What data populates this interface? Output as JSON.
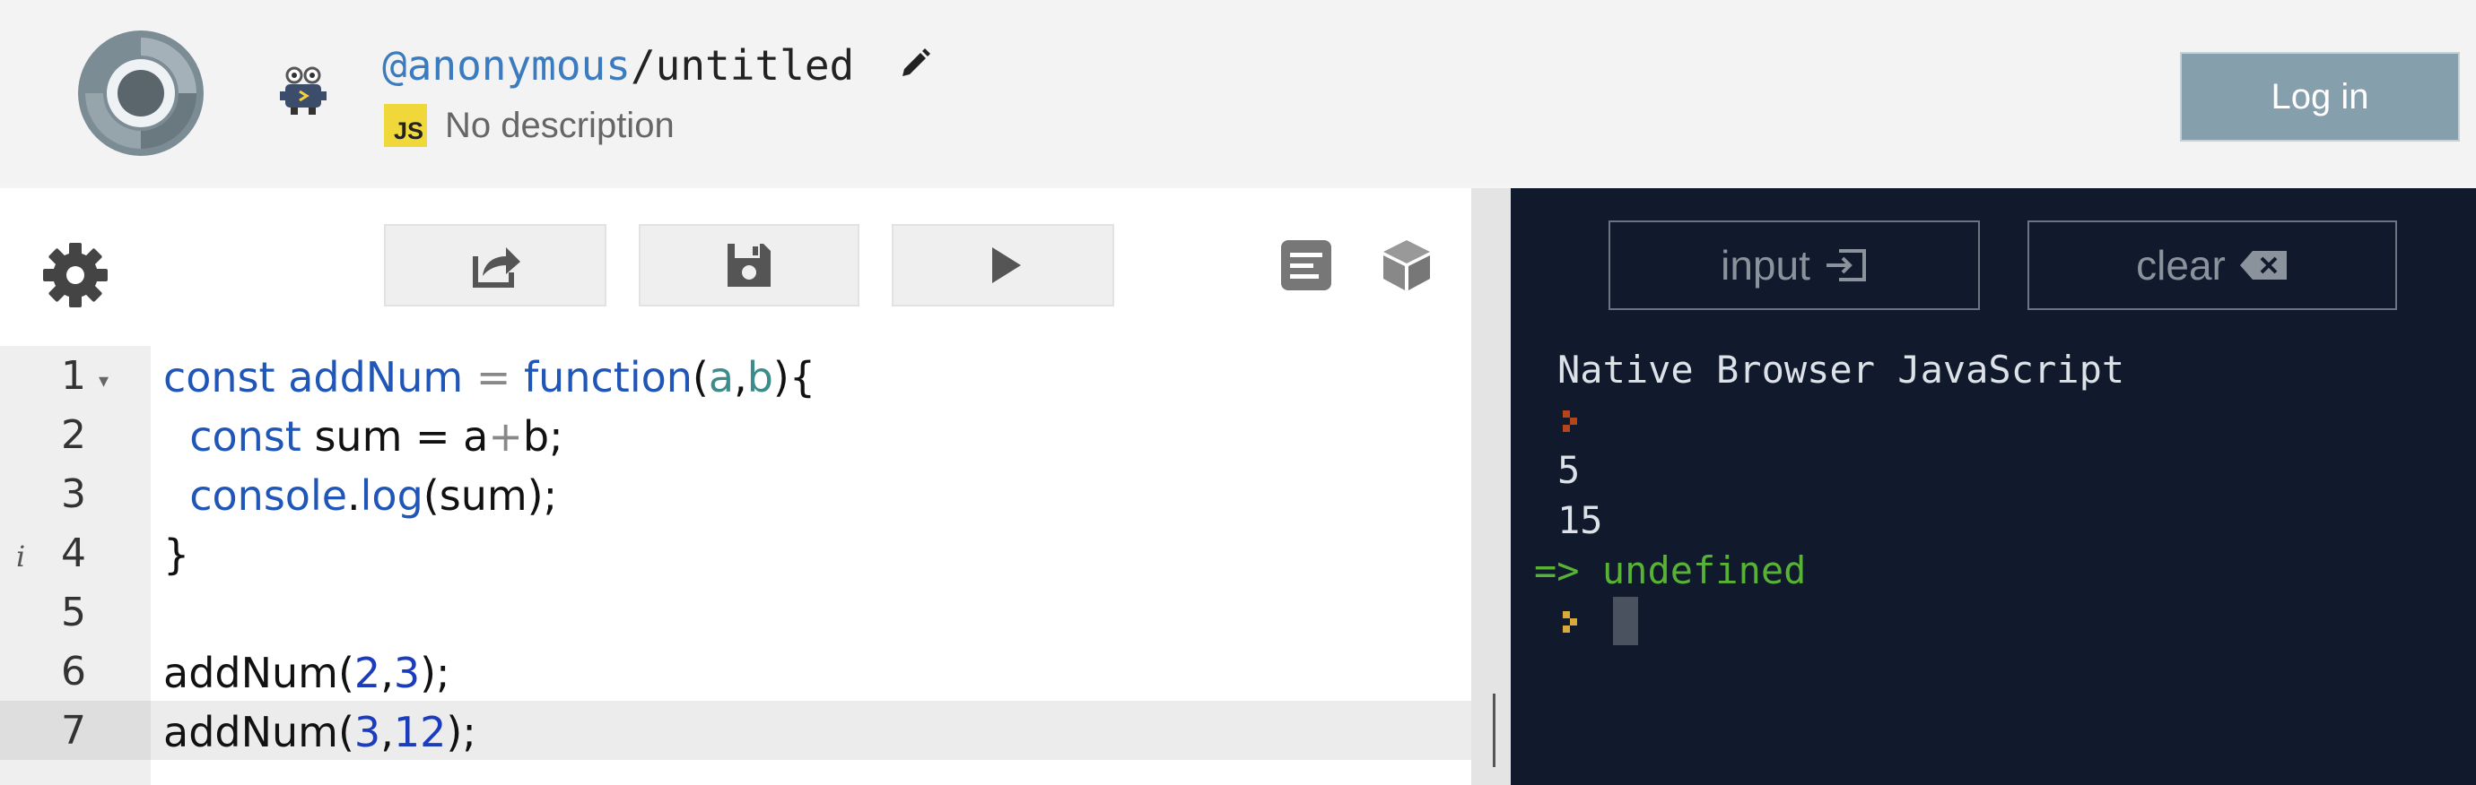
{
  "header": {
    "username": "@anonymous",
    "separator": "/",
    "repl_name": "untitled",
    "language_badge": "JS",
    "description": "No description",
    "login_label": "Log in"
  },
  "editor": {
    "toolbar": {
      "settings_icon": "gear-icon",
      "share_icon": "share-icon",
      "save_icon": "save-icon",
      "run_icon": "play-icon",
      "format_icon": "format-icon",
      "packages_icon": "cube-icon"
    },
    "lines": [
      {
        "n": "1"
      },
      {
        "n": "2"
      },
      {
        "n": "3"
      },
      {
        "n": "4"
      },
      {
        "n": "5"
      },
      {
        "n": "6"
      },
      {
        "n": "7"
      }
    ],
    "code": {
      "l1_const": "const",
      "l1_name": "addNum",
      "l1_eq": "=",
      "l1_function": "function",
      "l1_open": "(",
      "l1_a": "a",
      "l1_comma": ",",
      "l1_b": "b",
      "l1_close": "){",
      "l2_const": "const",
      "l2_rest": " sum = a",
      "l2_plus": "+",
      "l2_end": "b;",
      "l3_console": "console",
      "l3_dot": ".",
      "l3_log": "log",
      "l3_end": "(sum);",
      "l4": "}",
      "l6_call": "addNum(",
      "l6_a": "2",
      "l6_comma": ",",
      "l6_b": "3",
      "l6_end": ");",
      "l7_call": "addNum(",
      "l7_a": "3",
      "l7_comma": ",",
      "l7_b": "12",
      "l7_end": ");"
    },
    "fold_marker": "▾",
    "info_marker": "i",
    "active_line": "7"
  },
  "console": {
    "input_label": "input",
    "clear_label": "clear",
    "header_text": "Native Browser JavaScript",
    "output": [
      "5",
      "15"
    ],
    "result_arrow": "=>",
    "result_value": "undefined"
  },
  "colors": {
    "header_bg": "#f3f3f3",
    "login_bg": "#859fad",
    "console_bg": "#101a2c",
    "keyword": "#1f56b7",
    "result": "#58b236"
  }
}
